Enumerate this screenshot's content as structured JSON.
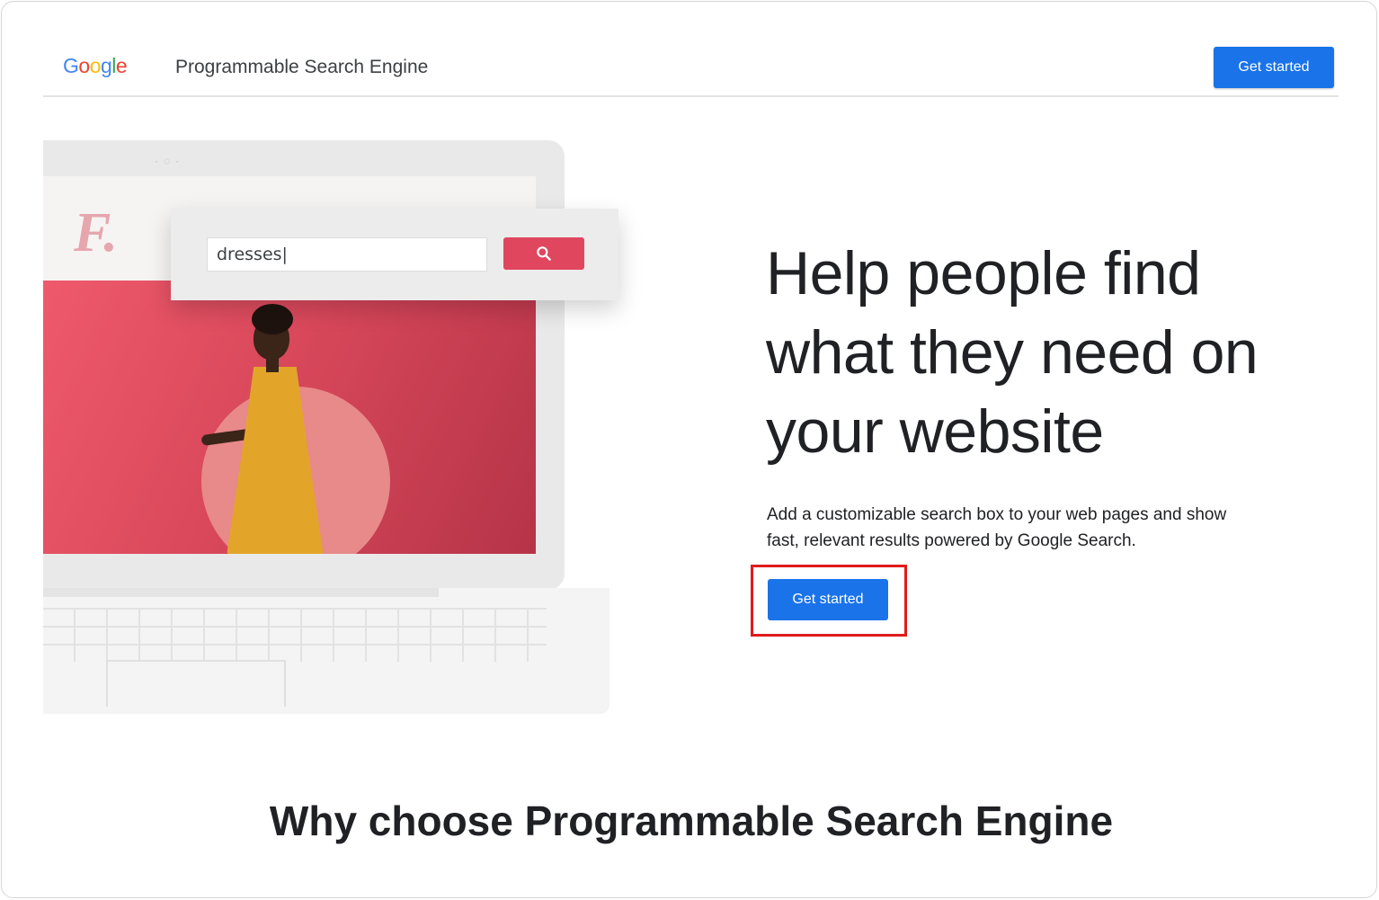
{
  "header": {
    "logo_letters": [
      {
        "char": "G",
        "color": "#4285F4"
      },
      {
        "char": "o",
        "color": "#EA4335"
      },
      {
        "char": "o",
        "color": "#FBBC05"
      },
      {
        "char": "g",
        "color": "#4285F4"
      },
      {
        "char": "l",
        "color": "#34A853"
      },
      {
        "char": "e",
        "color": "#EA4335"
      }
    ],
    "product_name": "Programmable Search Engine",
    "cta_label": "Get started"
  },
  "illustration": {
    "brand_letter": "F.",
    "search_value": "dresses|",
    "search_button_icon": "search-icon"
  },
  "hero": {
    "title": "Help people find what they need on your website",
    "description": "Add a customizable search box to your web pages and show fast, relevant results powered by Google Search.",
    "cta_label": "Get started"
  },
  "section": {
    "title": "Why choose Programmable Search Engine"
  },
  "colors": {
    "primary_button": "#1a73e8",
    "highlight_border": "#e01b1b",
    "search_button": "#e0475e"
  }
}
